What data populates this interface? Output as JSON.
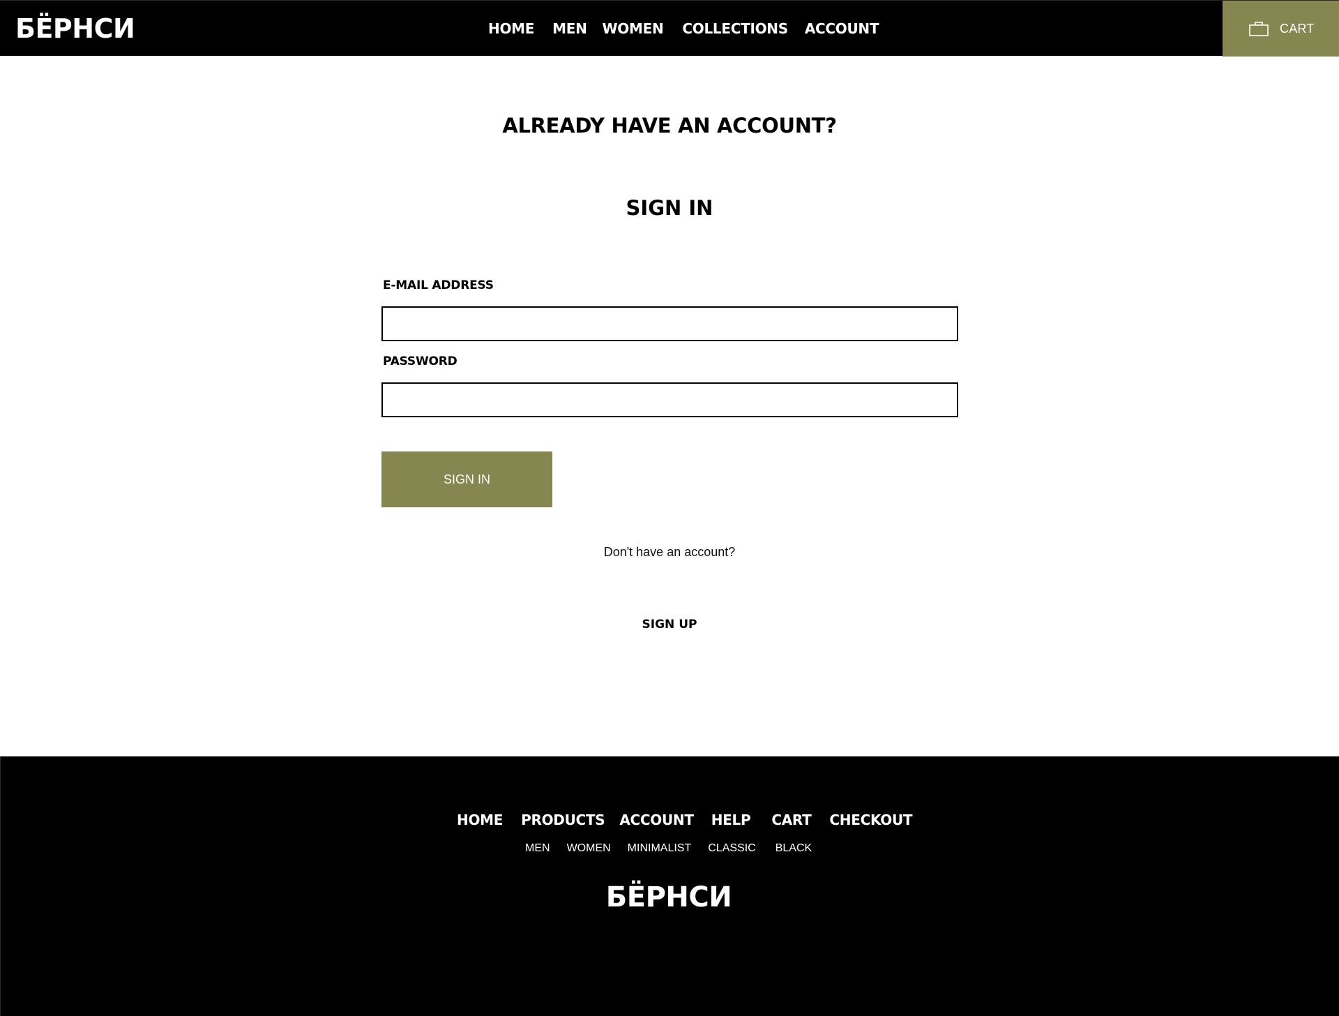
{
  "header": {
    "logo": "БЁРНСИ",
    "nav": [
      "HOME",
      "MEN",
      "WOMEN",
      "COLLECTIONS",
      "ACCOUNT"
    ],
    "cart_label": "CART",
    "cart_icon": "shopping-bag-icon"
  },
  "main": {
    "heading_already": "ALREADY HAVE AN ACCOUNT?",
    "heading_signin": "SIGN IN",
    "email_label": "E-MAIL ADDRESS",
    "email_value": "",
    "password_label": "PASSWORD",
    "password_value": "",
    "signin_button": "SIGN IN",
    "no_account_text": "Don't have an account?",
    "signup_link": "SIGN UP"
  },
  "footer": {
    "nav": [
      "HOME",
      "PRODUCTS",
      "ACCOUNT",
      "HELP",
      "CART",
      "CHECKOUT"
    ],
    "subnav": [
      "MEN",
      "WOMEN",
      "MINIMALIST",
      "CLASSIC",
      "BLACK"
    ],
    "logo": "БЁРНСИ"
  },
  "colors": {
    "accent": "#868650",
    "header_bg": "#000000",
    "footer_bg": "#000000",
    "page_bg": "#ffffff"
  }
}
